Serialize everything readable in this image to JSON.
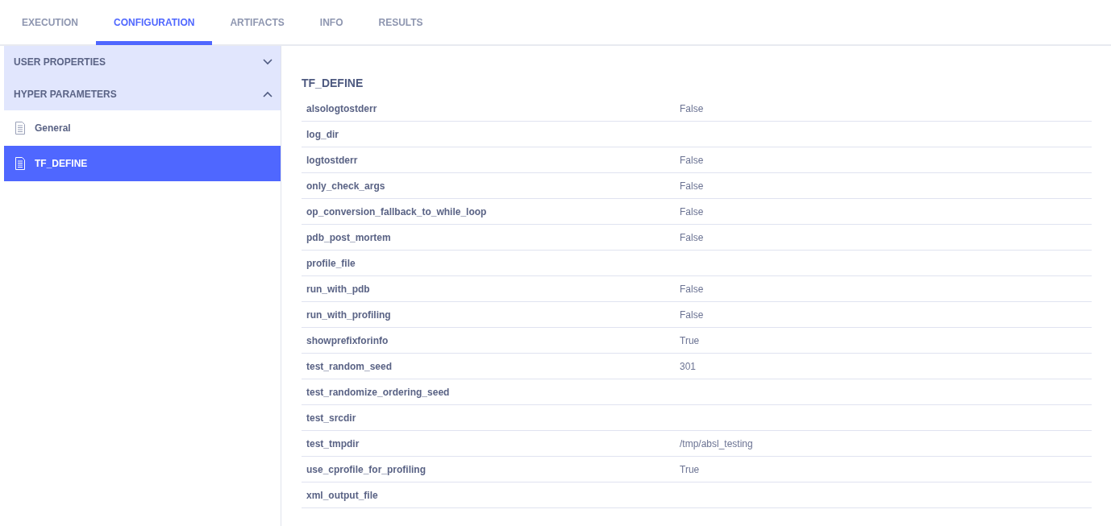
{
  "tabs": [
    {
      "label": "EXECUTION",
      "selected": false
    },
    {
      "label": "CONFIGURATION",
      "selected": true
    },
    {
      "label": "ARTIFACTS",
      "selected": false
    },
    {
      "label": "INFO",
      "selected": false
    },
    {
      "label": "RESULTS",
      "selected": false
    }
  ],
  "sidebar": {
    "sections": [
      {
        "label": "USER PROPERTIES",
        "expanded": false
      },
      {
        "label": "HYPER PARAMETERS",
        "expanded": true,
        "items": [
          {
            "label": "General",
            "selected": false
          },
          {
            "label": "TF_DEFINE",
            "selected": true
          }
        ]
      }
    ]
  },
  "panel": {
    "title": "TF_DEFINE",
    "rows": [
      {
        "name": "alsologtostderr",
        "value": "False"
      },
      {
        "name": "log_dir"
      },
      {
        "name": "logtostderr",
        "value": "False"
      },
      {
        "name": "only_check_args",
        "value": "False"
      },
      {
        "name": "op_conversion_fallback_to_while_loop",
        "value": "False"
      },
      {
        "name": "pdb_post_mortem",
        "value": "False"
      },
      {
        "name": "profile_file"
      },
      {
        "name": "run_with_pdb",
        "value": "False"
      },
      {
        "name": "run_with_profiling",
        "value": "False"
      },
      {
        "name": "showprefixforinfo",
        "value": "True"
      },
      {
        "name": "test_random_seed",
        "value": "301"
      },
      {
        "name": "test_randomize_ordering_seed"
      },
      {
        "name": "test_srcdir"
      },
      {
        "name": "test_tmpdir",
        "value": "/tmp/absl_testing"
      },
      {
        "name": "use_cprofile_for_profiling",
        "value": "True"
      },
      {
        "name": "xml_output_file"
      }
    ]
  }
}
